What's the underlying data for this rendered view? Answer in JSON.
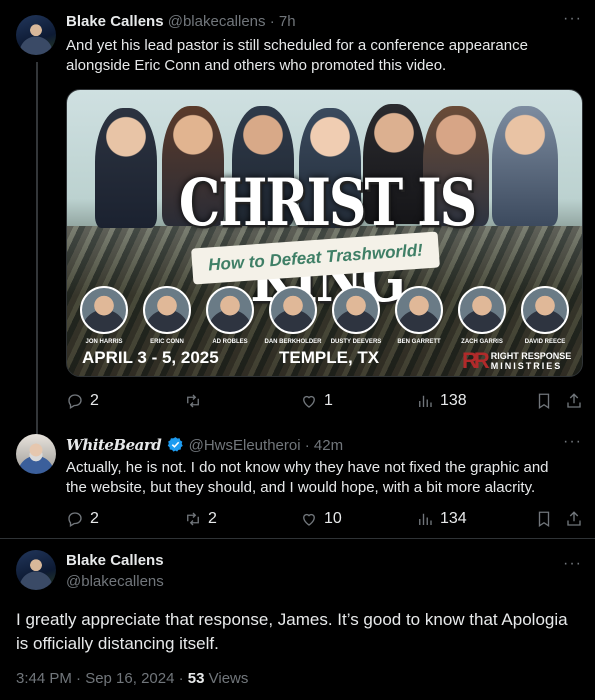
{
  "tweet1": {
    "name": "Blake Callens",
    "handle": "@blakecallens",
    "time": "7h",
    "text": "And yet his lead pastor is still scheduled for a conference appearance alongside Eric Conn and others who promoted this video.",
    "replies": "2",
    "retweets": "",
    "likes": "1",
    "views": "138"
  },
  "poster": {
    "title": "CHRIST IS KING",
    "subtitle": "How to Defeat Trashworld!",
    "speakers": [
      "JON HARRIS",
      "ERIC CONN",
      "AD ROBLES",
      "DAN BERKHOLDER",
      "DUSTY DEEVERS",
      "BEN GARRETT",
      "ZACH GARRIS",
      "DAVID REECE"
    ],
    "date": "APRIL 3 - 5, 2025",
    "location": "TEMPLE, TX",
    "logo_mark": "RR",
    "logo_line1": "RIGHT RESPONSE",
    "logo_line2": "MINISTRIES"
  },
  "tweet2": {
    "name": "WhiteBeard",
    "handle": "@HwsEleutheroi",
    "time": "42m",
    "text": "Actually, he is not.  I do not know why they have not fixed the graphic and the website, but they should, and I would hope, with a bit more alacrity.",
    "replies": "2",
    "retweets": "2",
    "likes": "10",
    "views": "134"
  },
  "main": {
    "name": "Blake Callens",
    "handle": "@blakecallens",
    "text": "I greatly appreciate that response, James. It’s good to know that Apologia is officially distancing itself.",
    "timestamp": "3:44 PM · Sep 16, 2024 · ",
    "views_count": "53",
    "views_label": " Views"
  },
  "colors": {
    "muted": "#71767b",
    "text": "#e7e9ea",
    "verified": "#1d9bf0",
    "divider": "#2f3336"
  },
  "icons": [
    "reply-icon",
    "retweet-icon",
    "like-icon",
    "views-icon",
    "bookmark-icon",
    "share-icon",
    "more-icon",
    "verified-icon"
  ]
}
